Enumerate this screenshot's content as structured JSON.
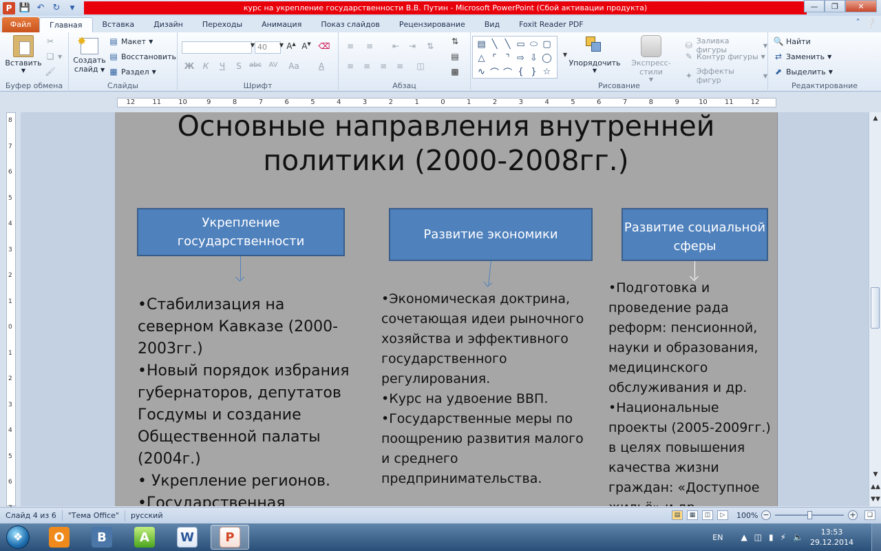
{
  "window": {
    "title": "курс на укрепление государственности В.В. Путин  -  Microsoft PowerPoint (Сбой активации продукта)"
  },
  "tabs": [
    "Файл",
    "Главная",
    "Вставка",
    "Дизайн",
    "Переходы",
    "Анимация",
    "Показ слайдов",
    "Рецензирование",
    "Вид",
    "Foxit Reader PDF"
  ],
  "active_tab": "Главная",
  "ribbon": {
    "clipboard": {
      "paste": "Вставить",
      "label": "Буфер обмена"
    },
    "slides": {
      "new_slide_line1": "Создать",
      "new_slide_line2": "слайд",
      "layout": "Макет",
      "reset": "Восстановить",
      "section": "Раздел",
      "label": "Слайды"
    },
    "font": {
      "font_size": "40",
      "label": "Шрифт",
      "bold": "Ж",
      "italic": "К",
      "underline": "Ч",
      "shadow": "S",
      "strike": "abc",
      "spacing": "AV",
      "case": "Aa",
      "color": "A"
    },
    "paragraph": {
      "label": "Абзац"
    },
    "drawing": {
      "arrange": "Упорядочить",
      "quick_styles": "Экспресс-стили",
      "fill": "Заливка фигуры",
      "outline": "Контур фигуры",
      "effects": "Эффекты фигур",
      "label": "Рисование"
    },
    "editing": {
      "find": "Найти",
      "replace": "Заменить",
      "select": "Выделить",
      "label": "Редактирование"
    }
  },
  "ruler": [
    "12",
    "11",
    "10",
    "9",
    "8",
    "7",
    "6",
    "5",
    "4",
    "3",
    "2",
    "1",
    "0",
    "1",
    "2",
    "3",
    "4",
    "5",
    "6",
    "7",
    "8",
    "9",
    "10",
    "11",
    "12"
  ],
  "vruler": [
    "8",
    "7",
    "6",
    "5",
    "4",
    "3",
    "2",
    "1",
    "0",
    "1",
    "2",
    "3",
    "4",
    "5",
    "6",
    "7"
  ],
  "slide": {
    "title_line1": "Основные направления внутренней",
    "title_line2": "политики (2000-2008гг.)",
    "box1": "Укрепление государственности",
    "box2": "Развитие экономики",
    "box3": "Развитие социальной сферы",
    "col1": [
      "•Стабилизация на северном Кавказе (2000-2003гг.)",
      "•Новый порядок избрания губернаторов, депутатов Госдумы и создание Общественной палаты (2004г.)",
      "• Укрепление регионов.",
      "•Государственная"
    ],
    "col2": [
      "•Экономическая доктрина, сочетающая идеи рыночного хозяйства и эффективного государственного регулирования.",
      "•Курс на удвоение ВВП.",
      "•Государственные меры по поощрению развития малого и среднего предпринимательства."
    ],
    "col3": [
      "•Подготовка и проведение рада реформ: пенсионной, науки и образования, медицинского обслуживания и др.",
      "•Национальные проекты (2005-2009гг.) в целях повышения качества жизни граждан: «Доступное",
      "жильё» и др."
    ]
  },
  "status": {
    "slide": "Слайд 4 из 6",
    "theme": "\"Тема Office\"",
    "language": "русский",
    "zoom": "100%",
    "zoom_fraction": 0.5
  },
  "taskbar": {
    "apps": [
      "odnoklassniki",
      "vkontakte",
      "access",
      "word",
      "powerpoint"
    ],
    "lang": "EN",
    "time": "13:53",
    "date": "29.12.2014"
  }
}
